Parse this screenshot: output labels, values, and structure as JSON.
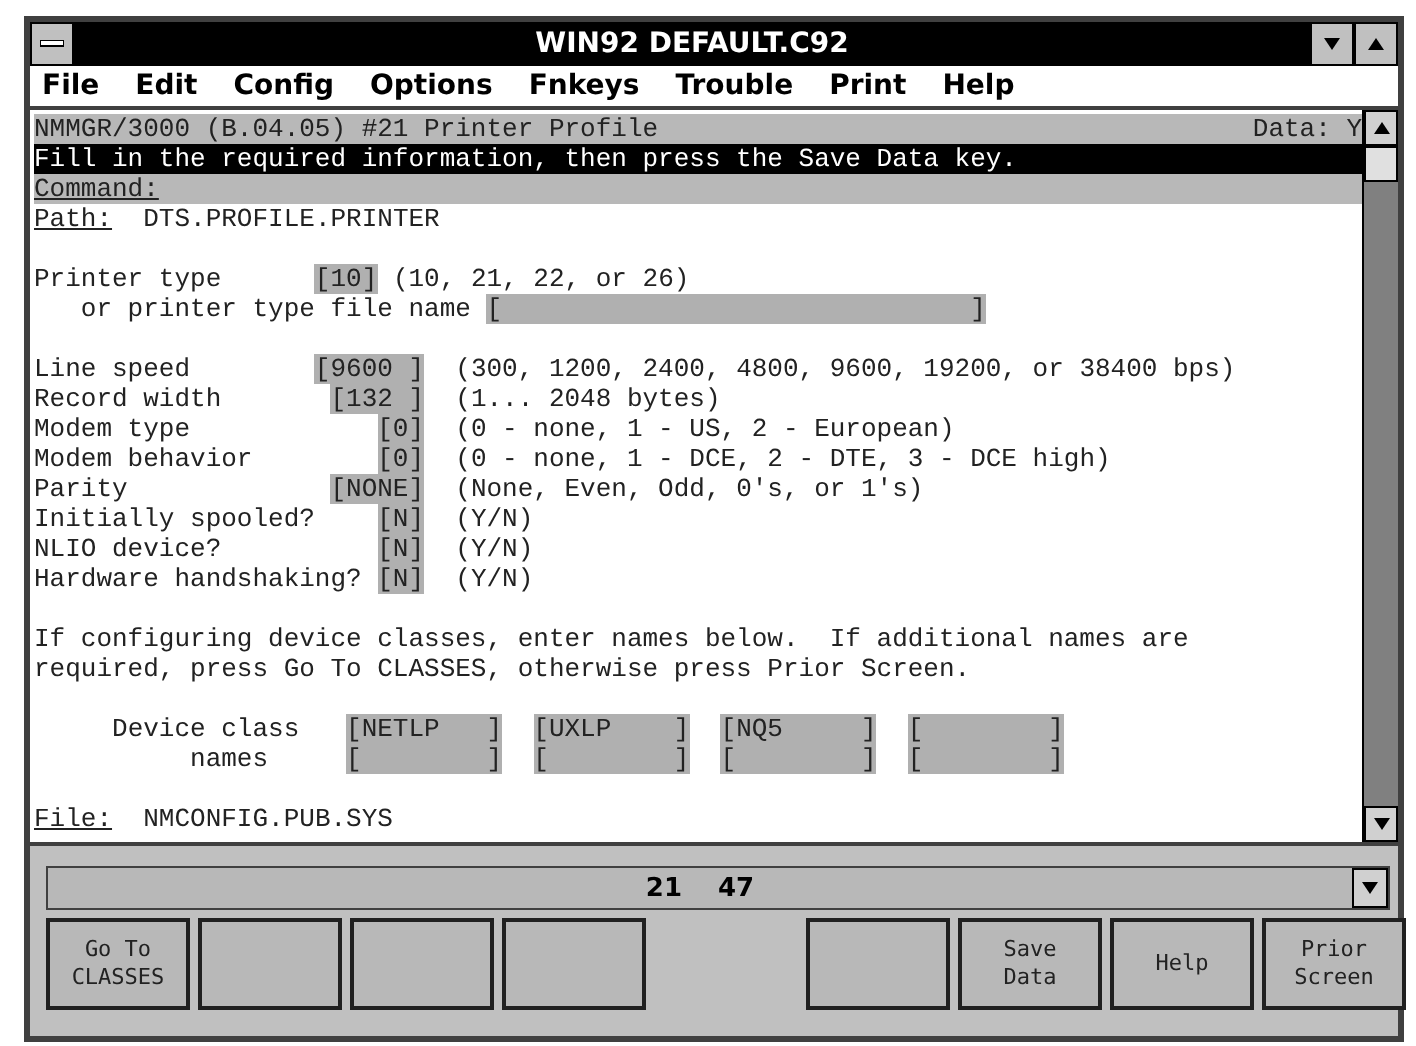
{
  "window": {
    "title": "WIN92 DEFAULT.C92"
  },
  "menu": [
    "File",
    "Edit",
    "Config",
    "Options",
    "Fnkeys",
    "Trouble",
    "Print",
    "Help"
  ],
  "screen": {
    "header": {
      "title": "NMMGR/3000 (B.04.05) #21 Printer Profile",
      "data": "Data: Y"
    },
    "prompt": "Fill in the required information, then press the Save Data key.",
    "command": {
      "label": "Command:"
    },
    "path": {
      "label": "Path:",
      "value": "DTS.PROFILE.PRINTER"
    },
    "printer_type": {
      "label": "Printer type",
      "value": "[10]",
      "hint": "(10, 21, 22, or 26)"
    },
    "printer_file": {
      "label": "or printer type file name",
      "value": "[                              ]"
    },
    "settings": [
      {
        "label": "Line speed",
        "value": "[9600 ]",
        "hint": "(300, 1200, 2400, 4800, 9600, 19200, or 38400 bps)"
      },
      {
        "label": "Record width",
        "value": "[132 ]",
        "hint": "(1... 2048 bytes)"
      },
      {
        "label": "Modem type",
        "value": "[0]",
        "hint": "(0 - none, 1 - US, 2 - European)"
      },
      {
        "label": "Modem behavior",
        "value": "[0]",
        "hint": "(0 - none, 1 - DCE, 2 - DTE, 3 - DCE high)"
      },
      {
        "label": "Parity",
        "value": "[NONE]",
        "hint": "(None, Even, Odd, 0's, or 1's)"
      },
      {
        "label": "Initially spooled?",
        "value": "[N]",
        "hint": "(Y/N)"
      },
      {
        "label": "NLIO device?",
        "value": "[N]",
        "hint": "(Y/N)"
      },
      {
        "label": "Hardware handshaking?",
        "value": "[N]",
        "hint": "(Y/N)"
      }
    ],
    "instructions": [
      "If configuring device classes, enter names below.  If additional names are",
      "required, press Go To CLASSES, otherwise press Prior Screen."
    ],
    "device_classes": {
      "label": "Device class",
      "label_2": "names",
      "fields": [
        [
          "[NETLP   ]",
          "[UXLP    ]",
          "[NQ5     ]",
          "[        ]"
        ],
        [
          "[        ]",
          "[        ]",
          "[        ]",
          "[        ]"
        ]
      ]
    },
    "file": {
      "label": "File:",
      "value": "NMCONFIG.PUB.SYS"
    }
  },
  "status": {
    "row": "21",
    "column": "47"
  },
  "function_keys": [
    {
      "kind": "key",
      "label": "Go To CLASSES"
    },
    {
      "kind": "blank"
    },
    {
      "kind": "blank"
    },
    {
      "kind": "blank"
    },
    {
      "kind": "gap"
    },
    {
      "kind": "blank"
    },
    {
      "kind": "key",
      "label": "Save Data"
    },
    {
      "kind": "key",
      "label": "Help"
    },
    {
      "kind": "key",
      "label": "Prior Screen"
    }
  ]
}
